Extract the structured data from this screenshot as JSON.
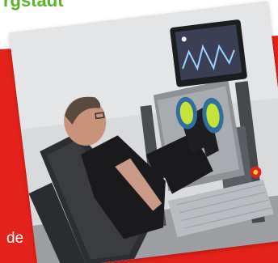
{
  "heading": {
    "partial_title": "rgstadt"
  },
  "caption": {
    "partial_text": "de"
  },
  "photo": {
    "description_icon": "leg-press-machine-photo"
  },
  "colors": {
    "brand_green": "#58b52a",
    "brand_red": "#e3231b",
    "photo_bg": "#d7d8da"
  }
}
